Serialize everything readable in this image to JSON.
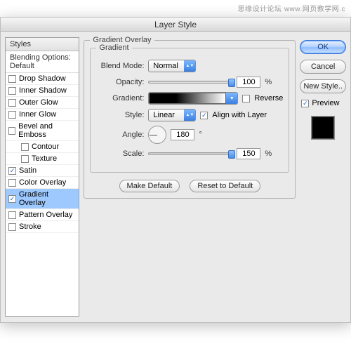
{
  "watermark": "思缘设计论坛  www.网页教学网.c",
  "dialog": {
    "title": "Layer Style"
  },
  "styles_panel": {
    "header": "Styles",
    "blending": "Blending Options: Default",
    "items": [
      {
        "label": "Drop Shadow",
        "checked": false,
        "indent": false
      },
      {
        "label": "Inner Shadow",
        "checked": false,
        "indent": false
      },
      {
        "label": "Outer Glow",
        "checked": false,
        "indent": false
      },
      {
        "label": "Inner Glow",
        "checked": false,
        "indent": false
      },
      {
        "label": "Bevel and Emboss",
        "checked": false,
        "indent": false
      },
      {
        "label": "Contour",
        "checked": false,
        "indent": true
      },
      {
        "label": "Texture",
        "checked": false,
        "indent": true
      },
      {
        "label": "Satin",
        "checked": true,
        "indent": false
      },
      {
        "label": "Color Overlay",
        "checked": false,
        "indent": false
      },
      {
        "label": "Gradient Overlay",
        "checked": true,
        "indent": false,
        "selected": true
      },
      {
        "label": "Pattern Overlay",
        "checked": false,
        "indent": false
      },
      {
        "label": "Stroke",
        "checked": false,
        "indent": false
      }
    ]
  },
  "center": {
    "group_title": "Gradient Overlay",
    "subgroup_title": "Gradient",
    "blend_mode": {
      "label": "Blend Mode:",
      "value": "Normal"
    },
    "opacity": {
      "label": "Opacity:",
      "value": "100",
      "unit": "%",
      "pct": 100
    },
    "gradient": {
      "label": "Gradient:"
    },
    "reverse": {
      "label": "Reverse",
      "checked": false
    },
    "style": {
      "label": "Style:",
      "value": "Linear"
    },
    "align": {
      "label": "Align with Layer",
      "checked": true
    },
    "angle": {
      "label": "Angle:",
      "value": "180",
      "unit": "°"
    },
    "scale": {
      "label": "Scale:",
      "value": "150",
      "unit": "%",
      "pct": 100
    },
    "make_default": "Make Default",
    "reset_default": "Reset to Default"
  },
  "right": {
    "ok": "OK",
    "cancel": "Cancel",
    "new_style": "New Style..",
    "preview": {
      "label": "Preview",
      "checked": true
    }
  }
}
